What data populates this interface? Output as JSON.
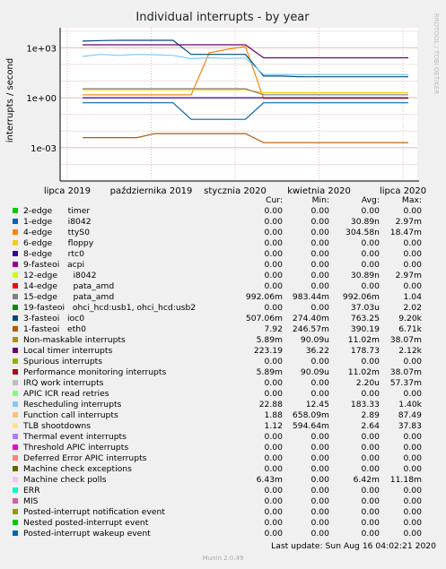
{
  "chart_data": {
    "type": "line",
    "title": "Individual interrupts - by year",
    "ylabel": "interrupts / second",
    "yscale": "log",
    "yticks": [
      "1e+03",
      "1e+00",
      "1e-03"
    ],
    "xticks": [
      "lipca 2019",
      "października 2019",
      "stycznia 2020",
      "kwietnia 2020",
      "lipca 2020"
    ],
    "side_label": "RRDTOOL / TOBI OETIKER",
    "grid": true,
    "series": [
      {
        "name": "2-edge timer",
        "color": "#00cc00",
        "values": []
      },
      {
        "name": "1-edge i8042",
        "color": "#0066b3",
        "values": [
          0.5,
          0.5,
          0.5,
          0.5,
          0.5,
          0.5,
          0.05,
          0.05,
          0.05,
          0.05,
          0.5,
          0.5,
          0.5,
          0.5,
          0.5,
          0.5,
          0.5,
          0.5,
          0.5
        ]
      },
      {
        "name": "4-edge ttyS0",
        "color": "#ff8000",
        "values": [
          1.5,
          1.5,
          1.5,
          1.5,
          1.5,
          1.5,
          1.5,
          500,
          800,
          1200,
          0.9,
          0.9,
          0.9,
          0.9,
          0.9,
          0.9,
          0.9,
          0.9,
          0.9
        ]
      },
      {
        "name": "6-edge floppy",
        "color": "#ffcc00",
        "values": [
          3,
          3,
          3,
          3,
          3,
          3,
          3,
          3,
          3,
          3,
          2,
          2,
          2,
          2,
          2,
          2,
          2,
          2,
          2
        ]
      },
      {
        "name": "8-edge rtc0",
        "color": "#330099",
        "values": [
          1,
          1,
          1,
          1,
          1,
          1,
          1,
          1,
          1,
          1,
          1,
          1,
          1,
          1,
          1,
          1,
          1,
          1,
          1
        ]
      },
      {
        "name": "9-fasteoi acpi",
        "color": "#990099",
        "values": []
      },
      {
        "name": "12-edge i8042",
        "color": "#ccff00",
        "values": []
      },
      {
        "name": "14-edge pata_amd",
        "color": "#ff0000",
        "values": []
      },
      {
        "name": "15-edge pata_amd",
        "color": "#808080",
        "values": [
          3.5,
          3.5,
          3.5,
          3.5,
          3.5,
          3.5,
          3.5,
          3.5,
          3.5,
          3.5,
          1.5,
          1.5,
          1.5,
          1.5,
          1.5,
          1.5,
          1.5,
          1.5,
          1.5
        ]
      },
      {
        "name": "19-fasteoi ohci_hcd:usb1, ohci_hcd:usb2",
        "color": "#008f00",
        "values": []
      },
      {
        "name": "3-fasteoi ioc0",
        "color": "#00487d",
        "values": [
          2500,
          2700,
          2800,
          2800,
          2800,
          2800,
          400,
          400,
          400,
          400,
          20,
          20,
          18,
          18,
          18,
          18,
          18,
          18,
          18
        ]
      },
      {
        "name": "1-fasteoi eth0",
        "color": "#b35a00",
        "values": [
          0.004,
          0.004,
          0.004,
          0.004,
          0.007,
          0.007,
          0.007,
          0.007,
          0.007,
          0.007,
          0.002,
          0.002,
          0.002,
          0.002,
          0.002,
          0.002,
          0.002,
          0.002,
          0.002
        ]
      },
      {
        "name": "Non-maskable interrupts",
        "color": "#b38f00",
        "values": []
      },
      {
        "name": "Local timer interrupts",
        "color": "#6b006b",
        "values": [
          1500,
          1500,
          1500,
          1500,
          1500,
          1500,
          1500,
          1500,
          1500,
          1500,
          250,
          250,
          250,
          250,
          250,
          250,
          250,
          250,
          250
        ]
      },
      {
        "name": "Spurious interrupts",
        "color": "#8fb300",
        "values": []
      },
      {
        "name": "Performance monitoring interrupts",
        "color": "#b30000",
        "values": []
      },
      {
        "name": "IRQ work interrupts",
        "color": "#bebebe",
        "values": []
      },
      {
        "name": "APIC ICR read retries",
        "color": "#80ff80",
        "values": []
      },
      {
        "name": "Rescheduling interrupts",
        "color": "#80c9ff",
        "values": [
          300,
          400,
          350,
          400,
          380,
          350,
          220,
          250,
          230,
          240,
          25,
          25,
          24,
          24,
          24,
          24,
          24,
          24,
          24
        ]
      },
      {
        "name": "Function call interrupts",
        "color": "#ffc080",
        "values": []
      },
      {
        "name": "TLB shootdowns",
        "color": "#ffe680",
        "values": []
      },
      {
        "name": "Thermal event interrupts",
        "color": "#aa80ff",
        "values": []
      },
      {
        "name": "Threshold APIC interrupts",
        "color": "#ee00cc",
        "values": []
      },
      {
        "name": "Deferred Error APIC interrupts",
        "color": "#ff8080",
        "values": []
      },
      {
        "name": "Machine check exceptions",
        "color": "#666600",
        "values": []
      },
      {
        "name": "Machine check polls",
        "color": "#ffbfff",
        "values": []
      },
      {
        "name": "ERR",
        "color": "#00ffcc",
        "values": []
      },
      {
        "name": "MIS",
        "color": "#cc6699",
        "values": []
      },
      {
        "name": "Posted-interrupt notification event",
        "color": "#999900",
        "values": []
      },
      {
        "name": "Nested posted-interrupt event",
        "color": "#00cc00",
        "values": []
      },
      {
        "name": "Posted-interrupt wakeup event",
        "color": "#0066b3",
        "values": []
      }
    ]
  },
  "legend": {
    "headers": {
      "cur": "Cur:",
      "min": "Min:",
      "avg": "Avg:",
      "max": "Max:"
    },
    "rows": [
      {
        "label": "2-edge      timer",
        "color": "#00cc00",
        "cur": "0.00",
        "min": "0.00",
        "avg": "0.00",
        "max": "0.00"
      },
      {
        "label": "1-edge      i8042",
        "color": "#0066b3",
        "cur": "0.00",
        "min": "0.00",
        "avg": "30.89n",
        "max": "2.97m"
      },
      {
        "label": "4-edge      ttyS0",
        "color": "#ff8000",
        "cur": "0.00",
        "min": "0.00",
        "avg": "304.58n",
        "max": "18.47m"
      },
      {
        "label": "6-edge      floppy",
        "color": "#ffcc00",
        "cur": "0.00",
        "min": "0.00",
        "avg": "0.00",
        "max": "0.00"
      },
      {
        "label": "8-edge      rtc0",
        "color": "#330099",
        "cur": "0.00",
        "min": "0.00",
        "avg": "0.00",
        "max": "0.00"
      },
      {
        "label": "9-fasteoi   acpi",
        "color": "#990099",
        "cur": "0.00",
        "min": "0.00",
        "avg": "0.00",
        "max": "0.00"
      },
      {
        "label": "12-edge      i8042",
        "color": "#ccff00",
        "cur": "0.00",
        "min": "0.00",
        "avg": "30.89n",
        "max": "2.97m"
      },
      {
        "label": "14-edge      pata_amd",
        "color": "#ff0000",
        "cur": "0.00",
        "min": "0.00",
        "avg": "0.00",
        "max": "0.00"
      },
      {
        "label": "15-edge      pata_amd",
        "color": "#808080",
        "cur": "992.06m",
        "min": "983.44m",
        "avg": "992.06m",
        "max": "1.04"
      },
      {
        "label": "19-fasteoi   ohci_hcd:usb1, ohci_hcd:usb2",
        "color": "#008f00",
        "cur": "0.00",
        "min": "0.00",
        "avg": "37.03u",
        "max": "2.02"
      },
      {
        "label": "3-fasteoi   ioc0",
        "color": "#00487d",
        "cur": "507.06m",
        "min": "274.40m",
        "avg": "763.25",
        "max": "9.20k"
      },
      {
        "label": "1-fasteoi   eth0",
        "color": "#b35a00",
        "cur": "7.92",
        "min": "246.57m",
        "avg": "390.19",
        "max": "6.71k"
      },
      {
        "label": "Non-maskable interrupts",
        "color": "#b38f00",
        "cur": "5.89m",
        "min": "90.09u",
        "avg": "11.02m",
        "max": "38.07m"
      },
      {
        "label": "Local timer interrupts",
        "color": "#6b006b",
        "cur": "223.19",
        "min": "36.22",
        "avg": "178.73",
        "max": "2.12k"
      },
      {
        "label": "Spurious interrupts",
        "color": "#8fb300",
        "cur": "0.00",
        "min": "0.00",
        "avg": "0.00",
        "max": "0.00"
      },
      {
        "label": "Performance monitoring interrupts",
        "color": "#b30000",
        "cur": "5.89m",
        "min": "90.09u",
        "avg": "11.02m",
        "max": "38.07m"
      },
      {
        "label": "IRQ work interrupts",
        "color": "#bebebe",
        "cur": "0.00",
        "min": "0.00",
        "avg": "2.20u",
        "max": "57.37m"
      },
      {
        "label": "APIC ICR read retries",
        "color": "#80ff80",
        "cur": "0.00",
        "min": "0.00",
        "avg": "0.00",
        "max": "0.00"
      },
      {
        "label": "Rescheduling interrupts",
        "color": "#80c9ff",
        "cur": "22.88",
        "min": "12.45",
        "avg": "183.33",
        "max": "1.40k"
      },
      {
        "label": "Function call interrupts",
        "color": "#ffc080",
        "cur": "1.88",
        "min": "658.09m",
        "avg": "2.89",
        "max": "87.49"
      },
      {
        "label": "TLB shootdowns",
        "color": "#ffe680",
        "cur": "1.12",
        "min": "594.64m",
        "avg": "2.64",
        "max": "37.83"
      },
      {
        "label": "Thermal event interrupts",
        "color": "#aa80ff",
        "cur": "0.00",
        "min": "0.00",
        "avg": "0.00",
        "max": "0.00"
      },
      {
        "label": "Threshold APIC interrupts",
        "color": "#ee00cc",
        "cur": "0.00",
        "min": "0.00",
        "avg": "0.00",
        "max": "0.00"
      },
      {
        "label": "Deferred Error APIC interrupts",
        "color": "#ff8080",
        "cur": "0.00",
        "min": "0.00",
        "avg": "0.00",
        "max": "0.00"
      },
      {
        "label": "Machine check exceptions",
        "color": "#666600",
        "cur": "0.00",
        "min": "0.00",
        "avg": "0.00",
        "max": "0.00"
      },
      {
        "label": "Machine check polls",
        "color": "#ffbfff",
        "cur": "6.43m",
        "min": "0.00",
        "avg": "6.42m",
        "max": "11.18m"
      },
      {
        "label": "ERR",
        "color": "#00ffcc",
        "cur": "0.00",
        "min": "0.00",
        "avg": "0.00",
        "max": "0.00"
      },
      {
        "label": "MIS",
        "color": "#cc6699",
        "cur": "0.00",
        "min": "0.00",
        "avg": "0.00",
        "max": "0.00"
      },
      {
        "label": "Posted-interrupt notification event",
        "color": "#999900",
        "cur": "0.00",
        "min": "0.00",
        "avg": "0.00",
        "max": "0.00"
      },
      {
        "label": "Nested posted-interrupt event",
        "color": "#00cc00",
        "cur": "0.00",
        "min": "0.00",
        "avg": "0.00",
        "max": "0.00"
      },
      {
        "label": "Posted-interrupt wakeup event",
        "color": "#0066b3",
        "cur": "0.00",
        "min": "0.00",
        "avg": "0.00",
        "max": "0.00"
      }
    ]
  },
  "footer": {
    "last_update": "Last update:  Sun Aug 16 04:02:21 2020",
    "munin": "Munin 2.0.49"
  }
}
